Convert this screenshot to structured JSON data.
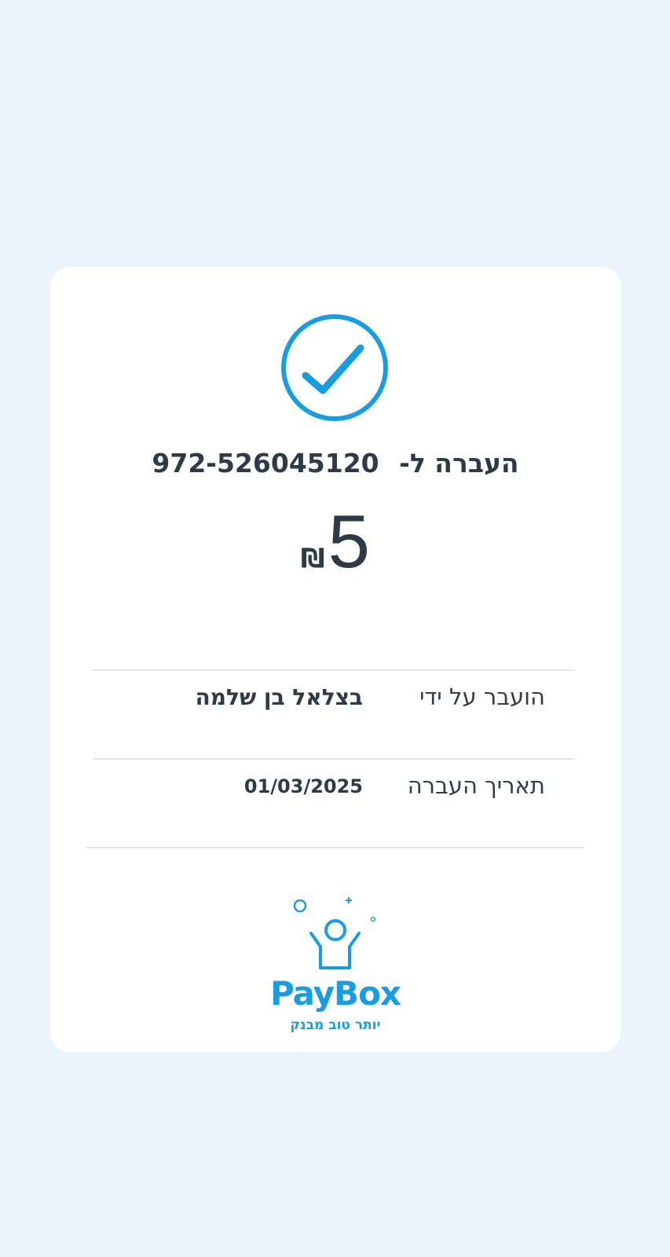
{
  "colors": {
    "background": "#edf3fb",
    "card": "#ffffff",
    "accent": "#1a9ce0",
    "text": "#2d3a47",
    "divider": "#e4e6ea"
  },
  "receipt": {
    "status_icon": "check-circle-icon",
    "title_label": "העברה ל-",
    "recipient_phone": "972-526045120",
    "amount_value": "5",
    "currency_symbol": "₪",
    "details": [
      {
        "label": "הועבר על ידי",
        "value": "בצלאל בן שלמה"
      },
      {
        "label": "תאריך העברה",
        "value": "01/03/2025"
      }
    ]
  },
  "brand": {
    "logo_icon": "paybox-person-icon",
    "name": "PayBox",
    "tagline": "יותר טוב מבנק"
  }
}
